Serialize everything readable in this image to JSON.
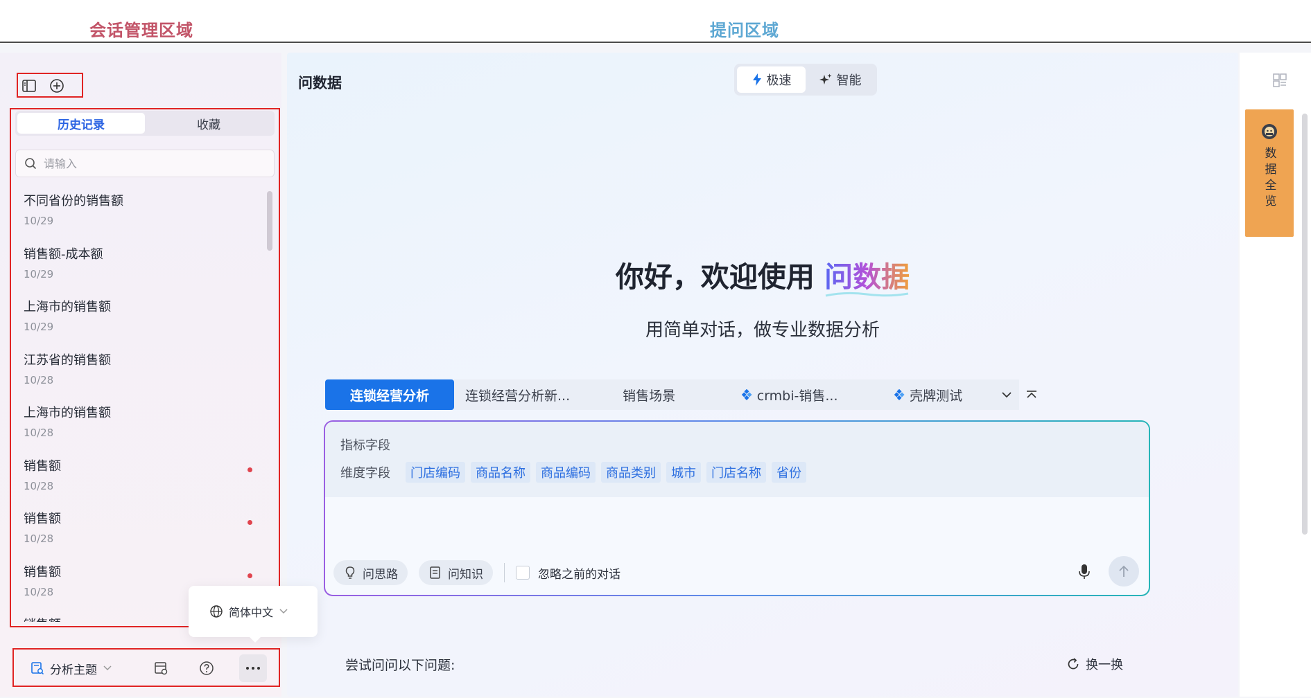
{
  "annotations": {
    "left_region": "会话管理区域",
    "right_region": "提问区域"
  },
  "sidebar": {
    "tabs": [
      {
        "label": "历史记录",
        "active": true
      },
      {
        "label": "收藏",
        "active": false
      }
    ],
    "search": {
      "placeholder": "请输入",
      "value": ""
    },
    "history": [
      {
        "title": "不同省份的销售额",
        "date": "10/29",
        "unread": false
      },
      {
        "title": "销售额-成本额",
        "date": "10/29",
        "unread": false
      },
      {
        "title": "上海市的销售额",
        "date": "10/29",
        "unread": false
      },
      {
        "title": "江苏省的销售额",
        "date": "10/28",
        "unread": false
      },
      {
        "title": "上海市的销售额",
        "date": "10/28",
        "unread": false
      },
      {
        "title": "销售额",
        "date": "10/28",
        "unread": true
      },
      {
        "title": "销售额",
        "date": "10/28",
        "unread": true
      },
      {
        "title": "销售额",
        "date": "10/28",
        "unread": true
      },
      {
        "title": "销售额",
        "date": "",
        "unread": false
      }
    ],
    "footer": {
      "topic_label": "分析主题"
    },
    "language_popup": {
      "label": "简体中文"
    }
  },
  "main": {
    "title": "问数据",
    "modes": [
      {
        "label": "极速",
        "active": true
      },
      {
        "label": "智能",
        "active": false
      }
    ],
    "welcome_prefix": "你好，欢迎使用 ",
    "welcome_brand": "问数据",
    "subtitle": "用简单对话，做专业数据分析",
    "topic_tabs": [
      {
        "label": "连锁经营分析",
        "active": true,
        "icon": ""
      },
      {
        "label": "连锁经营分析新...",
        "active": false,
        "icon": ""
      },
      {
        "label": "销售场景",
        "active": false,
        "icon": ""
      },
      {
        "label": "crmbi-销售...",
        "active": false,
        "icon": "diamond-icon"
      },
      {
        "label": "壳牌测试",
        "active": false,
        "icon": "diamond-icon"
      }
    ],
    "question_box": {
      "metric_label": "指标字段",
      "dimension_label": "维度字段",
      "dimensions": [
        "门店编码",
        "商品名称",
        "商品编码",
        "商品类别",
        "城市",
        "门店名称",
        "省份"
      ],
      "tool_think": "问思路",
      "tool_knowledge": "问知识",
      "ignore_label": "忽略之前的对话"
    },
    "suggest_label": "尝试问问以下问题:",
    "refresh_label": "换一换"
  },
  "rail": {
    "data_overview_label": "数据全览"
  },
  "colors": {
    "primary": "#1a73e8",
    "annotation_red": "#e02424",
    "accent_orange": "#efa452"
  }
}
